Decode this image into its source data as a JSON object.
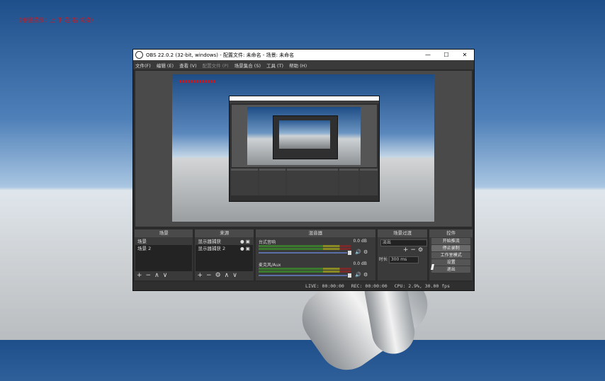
{
  "overlay_text": "（按键提示：上 下 左 右 切换）",
  "window": {
    "title": "OBS 22.0.2 (32-bit, windows) - 配置文件: 未命名 - 场景: 未命名",
    "minimize": "—",
    "maximize": "☐",
    "close": "✕"
  },
  "menu": [
    {
      "label": "文件(F)"
    },
    {
      "label": "编辑 (E)"
    },
    {
      "label": "查看 (V)"
    },
    {
      "label": "配置文件 (P)"
    },
    {
      "label": "场景集合 (S)"
    },
    {
      "label": "工具 (T)"
    },
    {
      "label": "帮助 (H)"
    }
  ],
  "docks": {
    "scenes": {
      "title": "场景",
      "items": [
        "场景",
        "场景 2"
      ]
    },
    "sources": {
      "title": "来源",
      "items": [
        "显示器捕获",
        "显示器捕获 2"
      ]
    },
    "mixer": {
      "title": "混音器",
      "channels": [
        {
          "name": "台式音响",
          "db": "0.0 dB",
          "level": 0.9
        },
        {
          "name": "麦克风/Aux",
          "db": "0.0 dB",
          "level": 0.9
        }
      ]
    },
    "transitions": {
      "title": "场景过渡",
      "selected": "淡出",
      "duration_label": "时长",
      "duration_value": "300 ms"
    },
    "controls": {
      "title": "控件",
      "buttons": [
        "开始推流",
        "停止录制",
        "工作室模式",
        "设置",
        "退出"
      ]
    }
  },
  "status": {
    "live": "LIVE: 00:00:00",
    "rec": "REC: 00:00:00",
    "cpu": "CPU: 2.9%, 30.00 fps"
  },
  "icons": {
    "add": "+",
    "remove": "−",
    "up": "∧",
    "down": "∨",
    "eye": "👁",
    "lock": "🔒",
    "speaker": "🔊",
    "gear": "⚙"
  }
}
